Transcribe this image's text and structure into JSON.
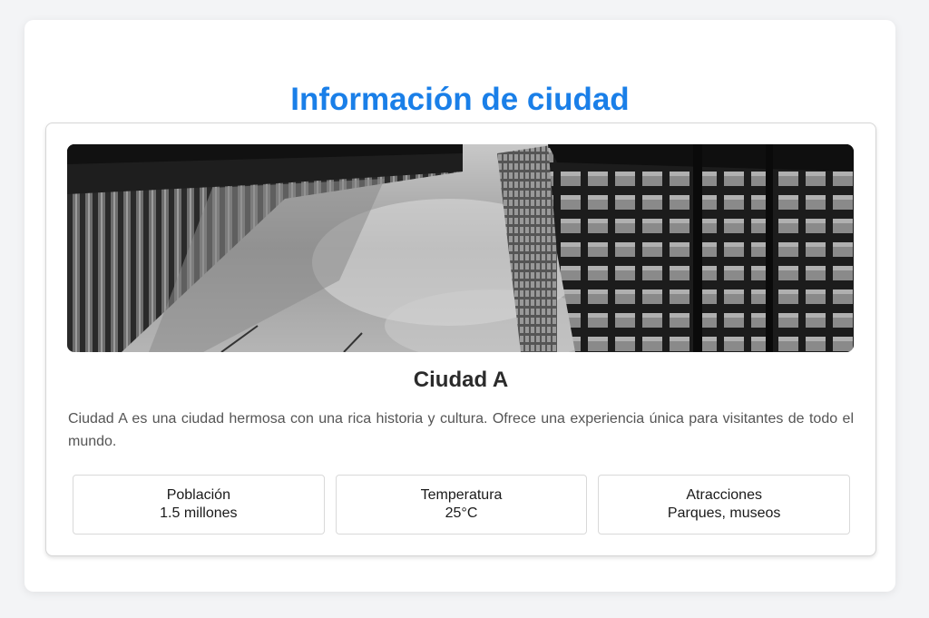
{
  "page": {
    "title": "Información de ciudad"
  },
  "city": {
    "name": "Ciudad A",
    "description": "Ciudad A es una ciudad hermosa con una rica historia y cultura. Ofrece una experiencia única para visitantes de todo el mundo.",
    "image_icon": "city-skyline-photo"
  },
  "stats": [
    {
      "label": "Población",
      "value": "1.5 millones"
    },
    {
      "label": "Temperatura",
      "value": "25°C"
    },
    {
      "label": "Atracciones",
      "value": "Parques, museos"
    }
  ],
  "colors": {
    "accent": "#1a7fe8",
    "background": "#f3f4f6",
    "card": "#ffffff",
    "text": "#2b2b2b"
  }
}
